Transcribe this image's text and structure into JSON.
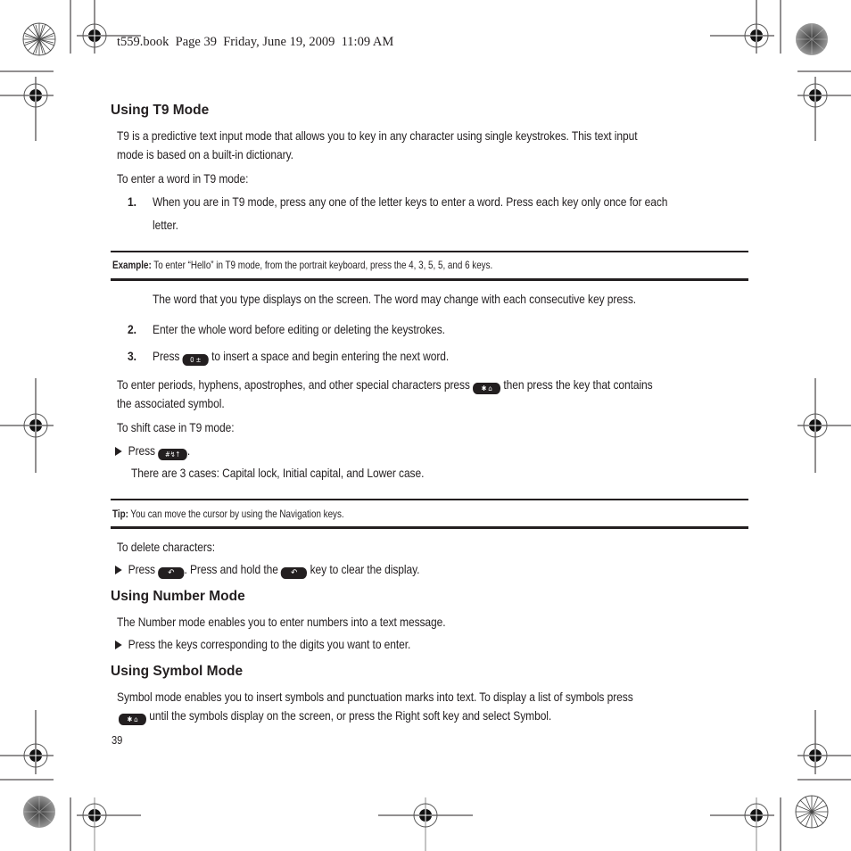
{
  "print_header": "t559.book  Page 39  Friday, June 19, 2009  11:09 AM",
  "sections": {
    "t9": {
      "heading": "Using T9 Mode",
      "intro_line1": "T9 is a predictive text input mode that allows you to key in any character using single keystrokes. This text input",
      "intro_line2": "mode is based on a built-in dictionary.",
      "enter_word": "To enter a word in T9 mode:",
      "step1_num": "1.",
      "step1_line1": "When you are in T9 mode, press any one of the letter keys to enter a word. Press each key only once for each",
      "step1_line2": "letter.",
      "example_label": "Example:",
      "example_text": " To enter “Hello” in T9 mode, from the portrait keyboard, press the 4, 3, 5, 5, and 6 keys.",
      "word_display": "The word that you type displays on the screen. The word may change with each consecutive key press.",
      "step2_num": "2.",
      "step2_text": "Enter the whole word before editing or deleting the keystrokes.",
      "step3_num": "3.",
      "step3_pre": "Press ",
      "step3_post": " to insert a space and begin entering the next word.",
      "special_pre": "To enter periods, hyphens, apostrophes, and other special characters press ",
      "special_post": " then press the key that contains",
      "special_line2": "the associated symbol.",
      "shift_intro": "To shift case in T9 mode:",
      "shift_pre": "Press ",
      "shift_post": ".",
      "cases": "There are 3 cases: Capital lock, Initial capital, and Lower case.",
      "tip_label": "Tip:",
      "tip_text": " You can move the cursor by using the Navigation keys.",
      "delete_intro": "To delete characters:",
      "delete_pre": "Press ",
      "delete_mid": ". Press and hold the ",
      "delete_post": " key to clear the display."
    },
    "number": {
      "heading": "Using Number Mode",
      "intro": "The Number mode enables you to enter numbers into a text message.",
      "bullet": "Press the keys corresponding to the digits you want to enter."
    },
    "symbol": {
      "heading": "Using Symbol Mode",
      "line1": "Symbol mode enables you to insert symbols and punctuation marks into text. To display a list of symbols press",
      "line2_post": " until the symbols display on the screen, or press the Right soft key and select Symbol."
    }
  },
  "keys": {
    "space_key": "0 ±",
    "star_key": "✱ ⌂",
    "shift_key": "#↯↑",
    "back_key": "↶"
  },
  "page_number": "39"
}
